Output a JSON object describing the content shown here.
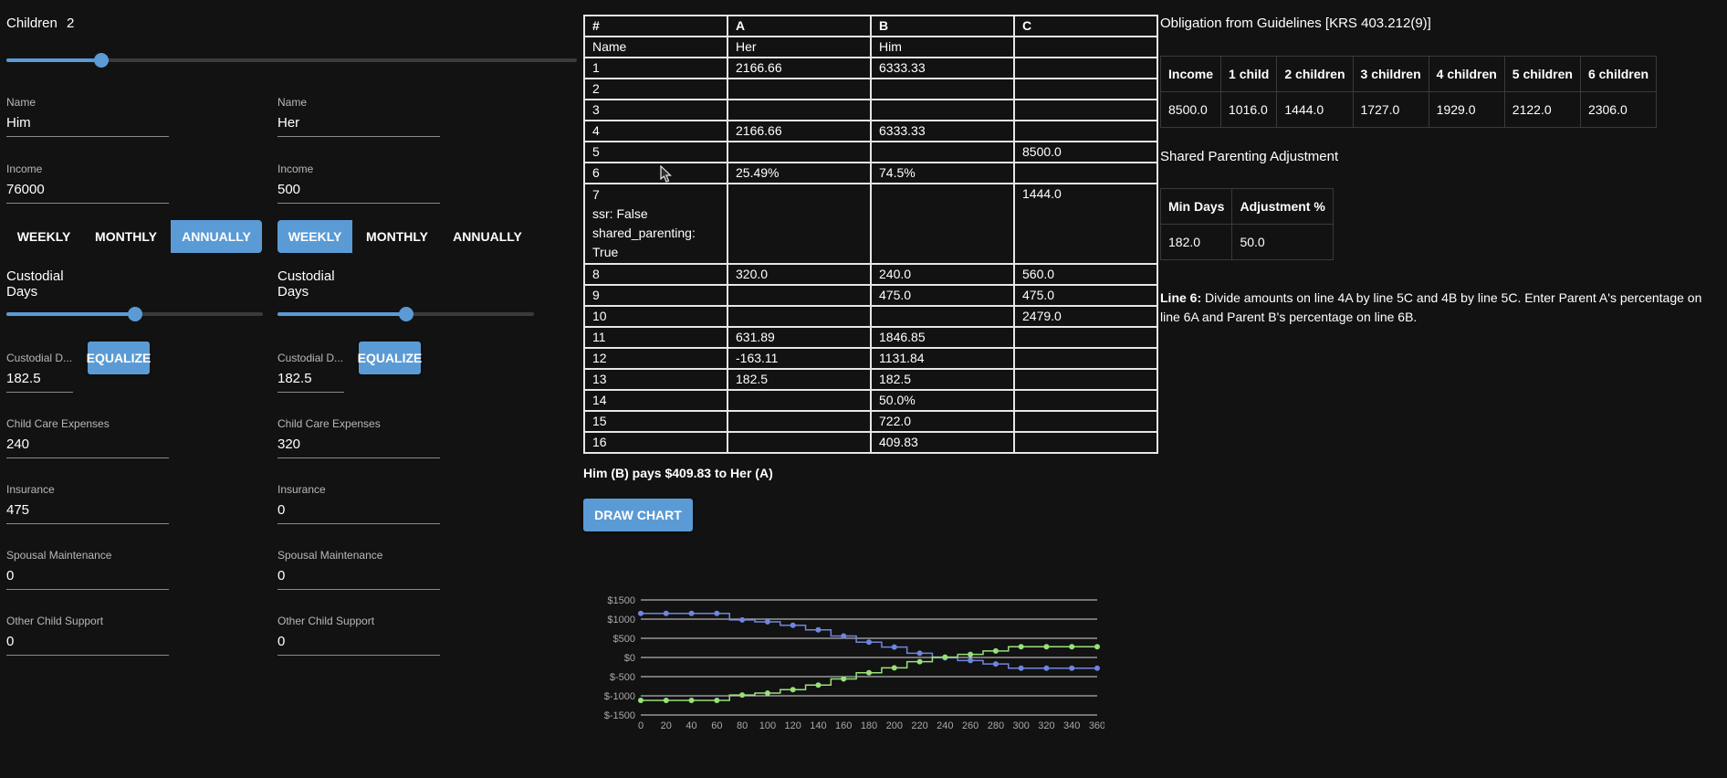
{
  "children": {
    "label": "Children",
    "count": "2",
    "value": 2,
    "max": 6
  },
  "parents": [
    {
      "name_label": "Name",
      "name": "Him",
      "income_label": "Income",
      "income": "76000",
      "freq": [
        "WEEKLY",
        "MONTHLY",
        "ANNUALLY"
      ],
      "freq_active": 2,
      "custodial_title": "Custodial Days",
      "custodial_fraction": 0.5,
      "custodial_field_label": "Custodial D...",
      "custodial_value": "182.5",
      "equalize_label": "EQUALIZE",
      "childcare_label": "Child Care Expenses",
      "childcare": "240",
      "insurance_label": "Insurance",
      "insurance": "475",
      "spousal_label": "Spousal Maintenance",
      "spousal": "0",
      "other_label": "Other Child Support",
      "other": "0"
    },
    {
      "name_label": "Name",
      "name": "Her",
      "income_label": "Income",
      "income": "500",
      "freq": [
        "WEEKLY",
        "MONTHLY",
        "ANNUALLY"
      ],
      "freq_active": 0,
      "custodial_title": "Custodial Days",
      "custodial_fraction": 0.5,
      "custodial_field_label": "Custodial D...",
      "custodial_value": "182.5",
      "equalize_label": "EQUALIZE",
      "childcare_label": "Child Care Expenses",
      "childcare": "320",
      "insurance_label": "Insurance",
      "insurance": "0",
      "spousal_label": "Spousal Maintenance",
      "spousal": "0",
      "other_label": "Other Child Support",
      "other": "0"
    }
  ],
  "worksheet": {
    "headers": [
      "#",
      "A",
      "B",
      "C"
    ],
    "rows": [
      [
        "Name",
        "Her",
        "Him",
        ""
      ],
      [
        "1",
        "2166.66",
        "6333.33",
        ""
      ],
      [
        "2",
        "",
        "",
        ""
      ],
      [
        "3",
        "",
        "",
        ""
      ],
      [
        "4",
        "2166.66",
        "6333.33",
        ""
      ],
      [
        "5",
        "",
        "",
        "8500.0"
      ],
      [
        "6",
        "25.49%",
        "74.5%",
        ""
      ],
      [
        "7",
        "",
        "",
        "1444.0"
      ],
      [
        "8",
        "320.0",
        "240.0",
        "560.0"
      ],
      [
        "9",
        "",
        "475.0",
        "475.0"
      ],
      [
        "10",
        "",
        "",
        "2479.0"
      ],
      [
        "11",
        "631.89",
        "1846.85",
        ""
      ],
      [
        "12",
        "-163.11",
        "1131.84",
        ""
      ],
      [
        "13",
        "182.5",
        "182.5",
        ""
      ],
      [
        "14",
        "",
        "50.0%",
        ""
      ],
      [
        "15",
        "",
        "722.0",
        ""
      ],
      [
        "16",
        "",
        "409.83",
        ""
      ]
    ],
    "row7_extra": [
      "ssr: False",
      "shared_parenting:",
      "True"
    ]
  },
  "payment_line": "Him (B) pays $409.83 to Her (A)",
  "draw_chart_label": "DRAW CHART",
  "obligation": {
    "title": "Obligation from Guidelines [KRS 403.212(9)]",
    "headers": [
      "Income",
      "1 child",
      "2 children",
      "3 children",
      "4 children",
      "5 children",
      "6 children"
    ],
    "row": [
      "8500.0",
      "1016.0",
      "1444.0",
      "1727.0",
      "1929.0",
      "2122.0",
      "2306.0"
    ]
  },
  "adjustment": {
    "title": "Shared Parenting Adjustment",
    "headers": [
      "Min Days",
      "Adjustment %"
    ],
    "row": [
      "182.0",
      "50.0"
    ]
  },
  "note": {
    "bold": "Line 6:",
    "text": " Divide amounts on line 4A by line 5C and 4B by line 5C. Enter Parent A's percentage on line 6A and Parent B's percentage on line 6B."
  },
  "colors": {
    "accent": "#5b9bd5",
    "series_a": "#6f86e0",
    "series_b": "#99e07a"
  },
  "chart_data": {
    "type": "line",
    "title": "",
    "xlabel": "",
    "ylabel": "",
    "xlim": [
      0,
      360
    ],
    "ylim": [
      -1500,
      1500
    ],
    "x_ticks": [
      0,
      20,
      40,
      60,
      80,
      100,
      120,
      140,
      160,
      180,
      200,
      220,
      240,
      260,
      280,
      300,
      320,
      340,
      360
    ],
    "y_ticks": [
      1500,
      1000,
      500,
      0,
      -500,
      -1000,
      -1500
    ],
    "y_tick_labels": [
      "$1500",
      "$1000",
      "$500",
      "$0",
      "$-500",
      "$-1000",
      "$-1500"
    ],
    "series": [
      {
        "color": "#6f86e0",
        "x": [
          0,
          20,
          40,
          60,
          80,
          100,
          120,
          140,
          160,
          180,
          200,
          220,
          240,
          260,
          280,
          300,
          320,
          340,
          360
        ],
        "y": [
          1150,
          1150,
          1150,
          1150,
          980,
          930,
          840,
          720,
          560,
          400,
          270,
          110,
          -10,
          -80,
          -170,
          -280,
          -280,
          -280,
          -280
        ]
      },
      {
        "color": "#99e07a",
        "x": [
          0,
          20,
          40,
          60,
          80,
          100,
          120,
          140,
          160,
          180,
          200,
          220,
          240,
          260,
          280,
          300,
          320,
          340,
          360
        ],
        "y": [
          -1120,
          -1120,
          -1120,
          -1120,
          -980,
          -930,
          -840,
          -720,
          -560,
          -400,
          -270,
          -110,
          10,
          80,
          170,
          280,
          280,
          280,
          280
        ]
      }
    ]
  }
}
